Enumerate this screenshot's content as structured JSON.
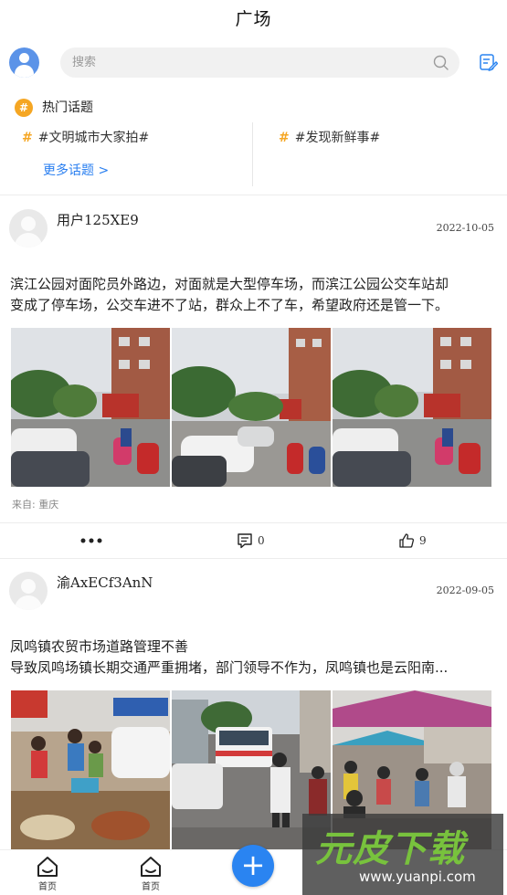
{
  "header": {
    "title": "广场"
  },
  "search": {
    "placeholder": "搜索"
  },
  "hot_topics": {
    "title": "热门话题",
    "badge": "#",
    "topics": [
      {
        "hash": "#",
        "label": "#文明城市大家拍#"
      },
      {
        "hash": "#",
        "label": "#发现新鲜事#"
      }
    ],
    "more_label": "更多话题 >"
  },
  "posts": [
    {
      "username": "用户125XE9",
      "date": "2022-10-05",
      "lines": [
        "滨江公园对面陀员外路边，对面就是大型停车场，而滨江公园公交车站却",
        "变成了停车场，公交车进不了站，群众上不了车，希望政府还是管一下。"
      ],
      "source": "来自: 重庆",
      "comment_count": "0",
      "like_count": "9"
    },
    {
      "username": "渝AxECf3AnN",
      "date": "2022-09-05",
      "lines": [
        "凤鸣镇农贸市场道路管理不善",
        "导致凤鸣场镇长期交通严重拥堵，部门领导不作为，凤鸣镇也是云阳南..."
      ]
    }
  ],
  "tabbar": {
    "home_label": "首页",
    "square_label": "首页",
    "add_label": "+"
  },
  "watermark": {
    "main": "元皮下载",
    "sub": "www.yuanpi.com"
  },
  "colors": {
    "accent": "#2a84f1",
    "topic_hash": "#f5a623",
    "link": "#2a7ff0"
  },
  "icons": [
    "user-avatar-icon",
    "search-icon",
    "edit-icon",
    "hash-icon",
    "more-dots-icon",
    "comment-icon",
    "like-icon",
    "home-icon",
    "plus-icon"
  ]
}
